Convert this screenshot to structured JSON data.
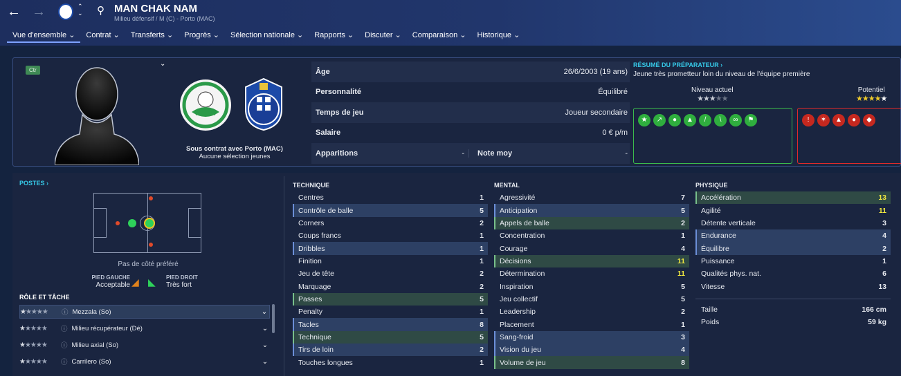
{
  "header": {
    "player_name": "MAN CHAK NAM",
    "subtitle": "Milieu défensif / M (C) - Porto (MAC)"
  },
  "menu": [
    "Vue d'ensemble",
    "Contrat",
    "Transferts",
    "Progrès",
    "Sélection nationale",
    "Rapports",
    "Discuter",
    "Comparaison",
    "Historique"
  ],
  "profile": {
    "role_badge": "Ctr",
    "contract_line1": "Sous contrat avec Porto (MAC)",
    "contract_line2": "Aucune sélection jeunes"
  },
  "info": [
    {
      "label": "Âge",
      "value": "26/6/2003 (19 ans)"
    },
    {
      "label": "Personnalité",
      "value": "Équilibré"
    },
    {
      "label": "Temps de jeu",
      "value": "Joueur secondaire"
    },
    {
      "label": "Salaire",
      "value": "0 € p/m"
    }
  ],
  "info_last": {
    "label1": "Apparitions",
    "value1": "-",
    "label2": "Note moy",
    "value2": "-"
  },
  "coach": {
    "title": "RÉSUMÉ DU PRÉPARATEUR ›",
    "text": "Jeune très prometteur loin du niveau de l'équipe première",
    "current_label": "Niveau actuel",
    "potential_label": "Potentiel",
    "current_stars": 2.5,
    "potential_stars": 4
  },
  "positions": {
    "title": "POSTES ›",
    "foot_pref": "Pas de côté préféré",
    "left_foot_label": "PIED GAUCHE",
    "left_foot_value": "Acceptable",
    "right_foot_label": "PIED DROIT",
    "right_foot_value": "Très fort"
  },
  "roles": {
    "title": "RÔLE ET TÂCHE",
    "items": [
      "Mezzala (So)",
      "Milieu récupérateur (Dé)",
      "Milieu axial (So)",
      "Carrilero (So)"
    ]
  },
  "technique": {
    "title": "TECHNIQUE",
    "rows": [
      {
        "n": "Centres",
        "v": "1"
      },
      {
        "n": "Contrôle de balle",
        "v": "5"
      },
      {
        "n": "Corners",
        "v": "2"
      },
      {
        "n": "Coups francs",
        "v": "1"
      },
      {
        "n": "Dribbles",
        "v": "1"
      },
      {
        "n": "Finition",
        "v": "1"
      },
      {
        "n": "Jeu de tête",
        "v": "2"
      },
      {
        "n": "Marquage",
        "v": "2"
      },
      {
        "n": "Passes",
        "v": "5"
      },
      {
        "n": "Penalty",
        "v": "1"
      },
      {
        "n": "Tacles",
        "v": "8"
      },
      {
        "n": "Technique",
        "v": "5"
      },
      {
        "n": "Tirs de loin",
        "v": "2"
      },
      {
        "n": "Touches longues",
        "v": "1"
      }
    ]
  },
  "mental": {
    "title": "MENTAL",
    "rows": [
      {
        "n": "Agressivité",
        "v": "7"
      },
      {
        "n": "Anticipation",
        "v": "5"
      },
      {
        "n": "Appels de balle",
        "v": "2"
      },
      {
        "n": "Concentration",
        "v": "1"
      },
      {
        "n": "Courage",
        "v": "4"
      },
      {
        "n": "Décisions",
        "v": "11"
      },
      {
        "n": "Détermination",
        "v": "11"
      },
      {
        "n": "Inspiration",
        "v": "5"
      },
      {
        "n": "Jeu collectif",
        "v": "5"
      },
      {
        "n": "Leadership",
        "v": "2"
      },
      {
        "n": "Placement",
        "v": "1"
      },
      {
        "n": "Sang-froid",
        "v": "3"
      },
      {
        "n": "Vision du jeu",
        "v": "4"
      },
      {
        "n": "Volume de jeu",
        "v": "8"
      }
    ]
  },
  "physique": {
    "title": "PHYSIQUE",
    "rows": [
      {
        "n": "Accélération",
        "v": "13"
      },
      {
        "n": "Agilité",
        "v": "11"
      },
      {
        "n": "Détente verticale",
        "v": "3"
      },
      {
        "n": "Endurance",
        "v": "4"
      },
      {
        "n": "Équilibre",
        "v": "2"
      },
      {
        "n": "Puissance",
        "v": "1"
      },
      {
        "n": "Qualités phys. nat.",
        "v": "6"
      },
      {
        "n": "Vitesse",
        "v": "13"
      }
    ],
    "height_label": "Taille",
    "height": "166 cm",
    "weight_label": "Poids",
    "weight": "59 kg"
  },
  "colors": {
    "accent": "#36c9e8",
    "highlight_blue": "#2d4064",
    "highlight_green": "#2f4a45",
    "good_box": "#3bbb4c",
    "bad_box": "#e02a2a",
    "top_value": "#f0e840"
  }
}
